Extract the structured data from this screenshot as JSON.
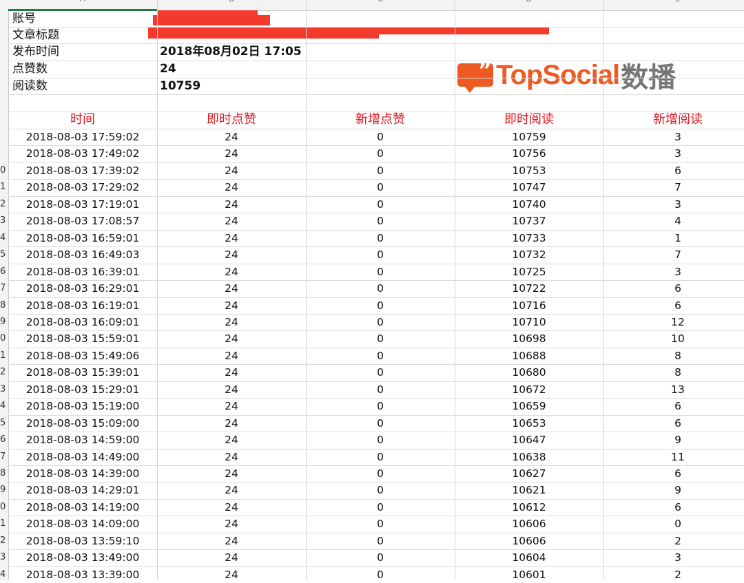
{
  "column_letters": [
    "A",
    "B",
    "C",
    "D",
    "E"
  ],
  "meta": [
    {
      "label": "账号",
      "value": ""
    },
    {
      "label": "文章标题",
      "value": ""
    },
    {
      "label": "发布时间",
      "value": "2018年08月02日 17:05"
    },
    {
      "label": "点赞数",
      "value": "24"
    },
    {
      "label": "阅读数",
      "value": "10759"
    }
  ],
  "logo": {
    "latin": "TopSocial",
    "cjk": "数播"
  },
  "headers": [
    "时间",
    "即时点赞",
    "新增点赞",
    "即时阅读",
    "新增阅读"
  ],
  "row_numbers": [
    "",
    "",
    "0",
    "1",
    "2",
    "3",
    "4",
    "5",
    "6",
    "7",
    "8",
    "9",
    "0",
    "1",
    "2",
    "3",
    "4",
    "5",
    "6",
    "7",
    "8",
    "9",
    "0",
    "1",
    "2",
    "3",
    "4"
  ],
  "rows": [
    [
      "2018-08-03 17:59:02",
      "24",
      "0",
      "10759",
      "3"
    ],
    [
      "2018-08-03 17:49:02",
      "24",
      "0",
      "10756",
      "3"
    ],
    [
      "2018-08-03 17:39:02",
      "24",
      "0",
      "10753",
      "6"
    ],
    [
      "2018-08-03 17:29:02",
      "24",
      "0",
      "10747",
      "7"
    ],
    [
      "2018-08-03 17:19:01",
      "24",
      "0",
      "10740",
      "3"
    ],
    [
      "2018-08-03 17:08:57",
      "24",
      "0",
      "10737",
      "4"
    ],
    [
      "2018-08-03 16:59:01",
      "24",
      "0",
      "10733",
      "1"
    ],
    [
      "2018-08-03 16:49:03",
      "24",
      "0",
      "10732",
      "7"
    ],
    [
      "2018-08-03 16:39:01",
      "24",
      "0",
      "10725",
      "3"
    ],
    [
      "2018-08-03 16:29:01",
      "24",
      "0",
      "10722",
      "6"
    ],
    [
      "2018-08-03 16:19:01",
      "24",
      "0",
      "10716",
      "6"
    ],
    [
      "2018-08-03 16:09:01",
      "24",
      "0",
      "10710",
      "12"
    ],
    [
      "2018-08-03 15:59:01",
      "24",
      "0",
      "10698",
      "10"
    ],
    [
      "2018-08-03 15:49:06",
      "24",
      "0",
      "10688",
      "8"
    ],
    [
      "2018-08-03 15:39:01",
      "24",
      "0",
      "10680",
      "8"
    ],
    [
      "2018-08-03 15:29:01",
      "24",
      "0",
      "10672",
      "13"
    ],
    [
      "2018-08-03 15:19:00",
      "24",
      "0",
      "10659",
      "6"
    ],
    [
      "2018-08-03 15:09:00",
      "24",
      "0",
      "10653",
      "6"
    ],
    [
      "2018-08-03 14:59:00",
      "24",
      "0",
      "10647",
      "9"
    ],
    [
      "2018-08-03 14:49:00",
      "24",
      "0",
      "10638",
      "11"
    ],
    [
      "2018-08-03 14:39:00",
      "24",
      "0",
      "10627",
      "6"
    ],
    [
      "2018-08-03 14:29:01",
      "24",
      "0",
      "10621",
      "9"
    ],
    [
      "2018-08-03 14:19:00",
      "24",
      "0",
      "10612",
      "6"
    ],
    [
      "2018-08-03 14:09:00",
      "24",
      "0",
      "10606",
      "0"
    ],
    [
      "2018-08-03 13:59:10",
      "24",
      "0",
      "10606",
      "2"
    ],
    [
      "2018-08-03 13:49:00",
      "24",
      "0",
      "10604",
      "3"
    ],
    [
      "2018-08-03 13:39:00",
      "24",
      "0",
      "10601",
      "2"
    ]
  ],
  "colors": {
    "header_red": "#e0181f",
    "redaction": "#f23a2d",
    "logo_orange": "#ee5a24",
    "logo_gray": "#767676"
  }
}
